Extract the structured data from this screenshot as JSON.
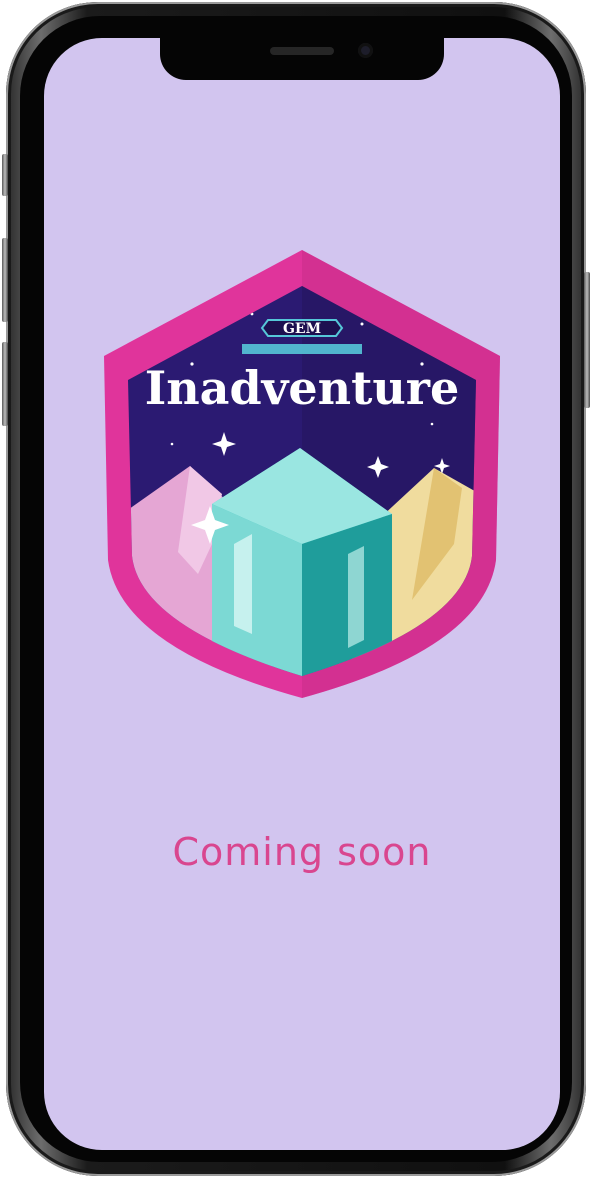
{
  "app": {
    "badge_kicker": "GEM",
    "badge_title": "Inadventure",
    "status_text": "Coming soon"
  },
  "colors": {
    "screen_background": "#d2c5ef",
    "accent_pink": "#d9468f",
    "badge_border": "#e0349b",
    "badge_sky": "#2b1a72",
    "gem_teal": "#3dc4c1"
  },
  "icons": {
    "badge": "gem-inadventure-shield-logo"
  }
}
